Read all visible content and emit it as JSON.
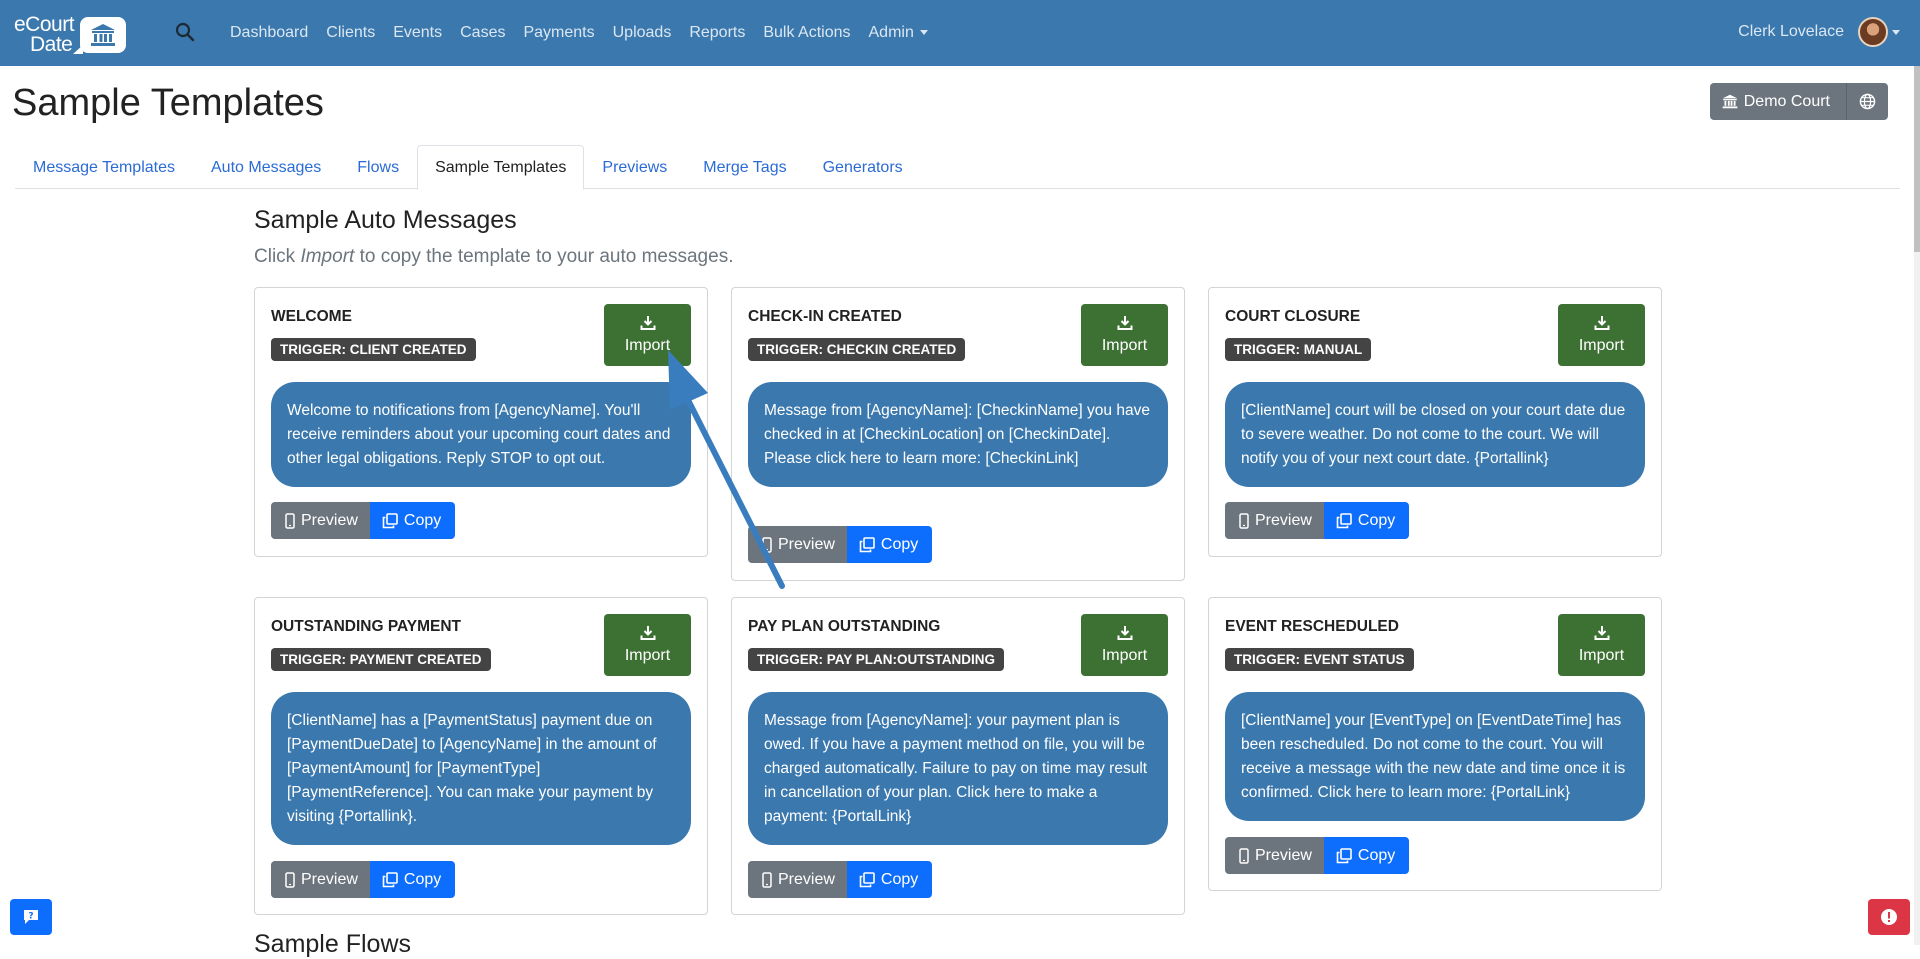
{
  "logo": {
    "line1": "eCourt",
    "line2": "Date"
  },
  "nav": {
    "links": [
      "Dashboard",
      "Clients",
      "Events",
      "Cases",
      "Payments",
      "Uploads",
      "Reports",
      "Bulk Actions",
      "Admin"
    ],
    "user_name": "Clerk Lovelace"
  },
  "page": {
    "title": "Sample Templates",
    "court_button": "Demo Court"
  },
  "tabs": [
    "Message Templates",
    "Auto Messages",
    "Flows",
    "Sample Templates",
    "Previews",
    "Merge Tags",
    "Generators"
  ],
  "active_tab": "Sample Templates",
  "section": {
    "title": "Sample Auto Messages",
    "subtitle_prefix": "Click ",
    "subtitle_em": "Import",
    "subtitle_suffix": " to copy the template to your auto messages.",
    "next_title": "Sample Flows"
  },
  "buttons": {
    "import": "Import",
    "preview": "Preview",
    "copy": "Copy"
  },
  "cards": [
    {
      "name": "WELCOME",
      "trigger": "TRIGGER: CLIENT CREATED",
      "message": "Welcome to notifications from [AgencyName]. You'll receive reminders about your upcoming court dates and other legal obligations. Reply STOP to opt out."
    },
    {
      "name": "CHECK-IN CREATED",
      "trigger": "TRIGGER: CHECKIN CREATED",
      "message": "Message from [AgencyName]: [CheckinName] you have checked in at [CheckinLocation] on [CheckinDate]. Please click here to learn more: [CheckinLink]"
    },
    {
      "name": "COURT CLOSURE",
      "trigger": "TRIGGER: MANUAL",
      "message": "[ClientName] court will be closed on your court date due to severe weather. Do not come to the court. We will notify you of your next court date. {Portallink}"
    },
    {
      "name": "OUTSTANDING PAYMENT",
      "trigger": "TRIGGER: PAYMENT CREATED",
      "message": "[ClientName] has a [PaymentStatus] payment due on [PaymentDueDate] to [AgencyName] in the amount of [PaymentAmount] for [PaymentType] [PaymentReference]. You can make your payment by visiting {Portallink}."
    },
    {
      "name": "PAY PLAN OUTSTANDING",
      "trigger": "TRIGGER: PAY PLAN:OUTSTANDING",
      "message": "Message from [AgencyName]: your payment plan is owed. If you have a payment method on file, you will be charged automatically. Failure to pay on time may result in cancellation of your plan. Click here to make a payment: {PortalLink}"
    },
    {
      "name": "EVENT RESCHEDULED",
      "trigger": "TRIGGER: EVENT STATUS",
      "message": "[ClientName] your [EventType] on [EventDateTime] has been rescheduled. Do not come to the court. You will receive a message with the new date and time once it is confirmed. Click here to learn more: {PortalLink}"
    }
  ],
  "colors": {
    "navbar": "#3a78ad",
    "import_button": "#3d7033",
    "bubble": "#3a78ad",
    "preview_button": "#6c757d",
    "copy_button": "#0d6efd",
    "trigger_badge": "#444444",
    "annotation_arrow": "#3a7dbf"
  }
}
